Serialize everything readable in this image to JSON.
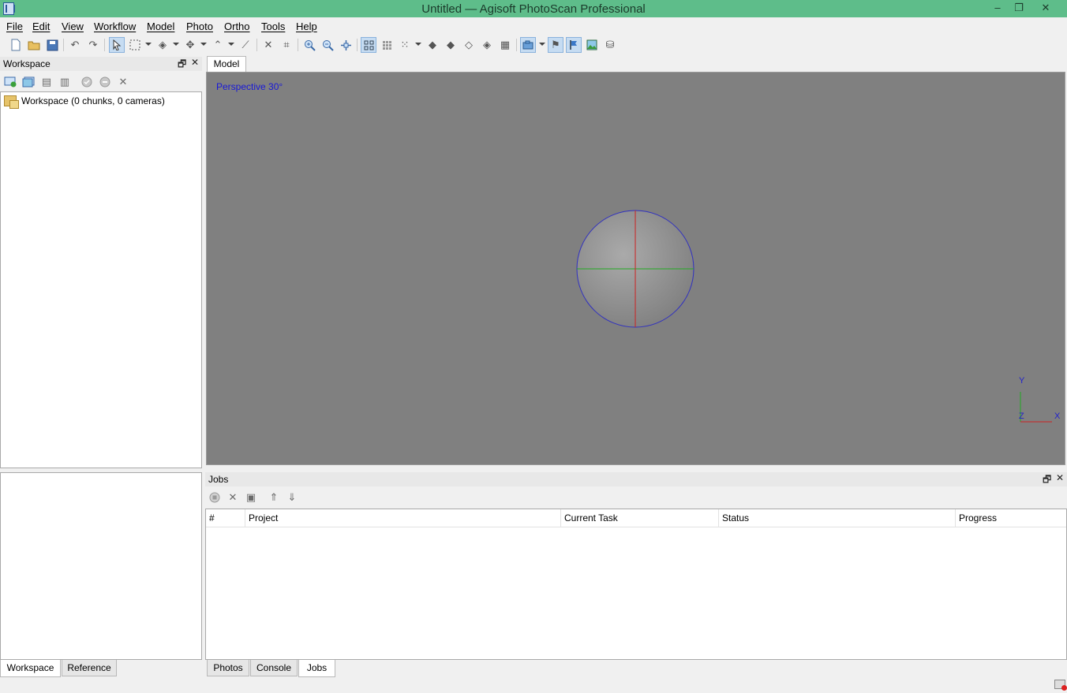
{
  "window": {
    "title": "Untitled — Agisoft PhotoScan Professional",
    "controls": {
      "minimize": "–",
      "restore": "❐",
      "close": "✕"
    }
  },
  "menu": [
    "File",
    "Edit",
    "View",
    "Workflow",
    "Model",
    "Photo",
    "Ortho",
    "Tools",
    "Help"
  ],
  "toolbar": {
    "icons": [
      "new-document-icon",
      "open-folder-icon",
      "save-icon",
      "undo-icon",
      "redo-icon",
      "navigation-icon",
      "rectangle-selection-icon",
      "shape-icon",
      "move-icon",
      "draw-polyline-icon",
      "ruler-icon",
      "delete-icon",
      "crop-icon",
      "zoom-in-icon",
      "zoom-out-icon",
      "reset-view-icon",
      "grid-view-icon",
      "small-grid-icon",
      "dense-cloud-icon",
      "shaded-model-icon",
      "solid-model-icon",
      "wireframe-icon",
      "textured-model-icon",
      "tiled-model-icon",
      "show-cameras-icon",
      "show-markers-icon",
      "show-shapes-icon",
      "show-images-icon",
      "show-region-icon"
    ]
  },
  "workspace": {
    "title": "Workspace",
    "tree_root": "Workspace (0 chunks, 0 cameras)",
    "tools": [
      "add-chunk-icon",
      "add-photos-icon",
      "add-folder-icon",
      "delete-chunk-icon",
      "enable-icon",
      "disable-icon",
      "remove-icon"
    ]
  },
  "left_tabs": [
    "Workspace",
    "Reference"
  ],
  "model": {
    "tab": "Model",
    "projection": "Perspective 30°",
    "axes": {
      "y": "Y",
      "z": "Z",
      "x": "X"
    },
    "colors": {
      "background": "#808080",
      "sphere_outline": "#3030c0",
      "axis_red": "#cc2222",
      "axis_green": "#22aa22",
      "label_blue": "#1818d8"
    }
  },
  "jobs": {
    "title": "Jobs",
    "tools": [
      "stop-job-icon",
      "remove-job-icon",
      "copy-job-icon",
      "move-up-icon",
      "move-down-icon"
    ],
    "columns": [
      "#",
      "Project",
      "Current Task",
      "Status",
      "Progress"
    ],
    "rows": []
  },
  "right_tabs": [
    "Photos",
    "Console",
    "Jobs"
  ],
  "panel_controls": {
    "float": "🗗",
    "close": "✕"
  }
}
